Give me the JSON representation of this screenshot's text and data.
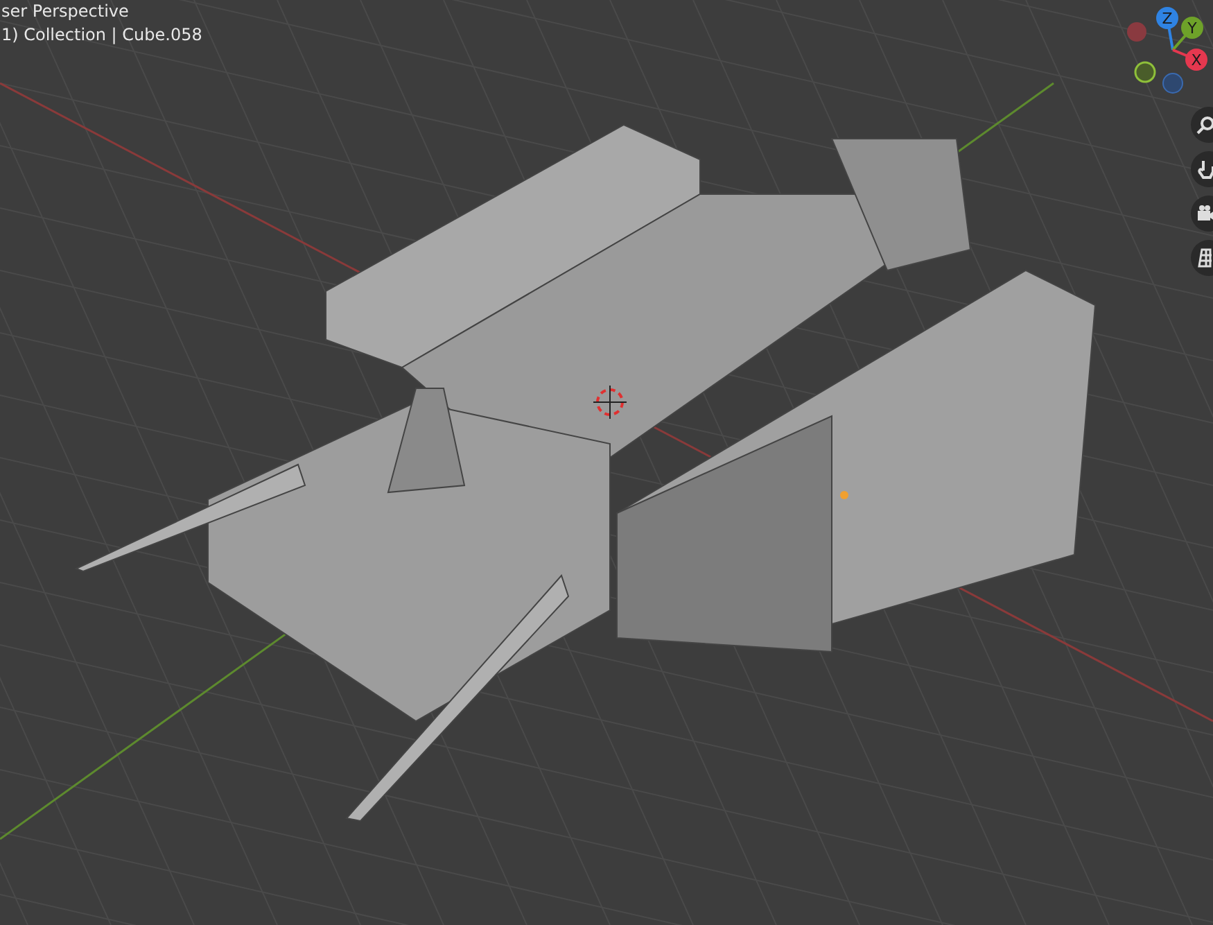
{
  "viewport": {
    "view_name": "ser Perspective",
    "collection_label": "1) Collection | Cube.058"
  },
  "gizmo": {
    "axes": [
      {
        "label": "Z",
        "color": "#2f83e3"
      },
      {
        "label": "Y",
        "color": "#6ea229"
      },
      {
        "label": "X",
        "color": "#e5384f"
      }
    ]
  }
}
